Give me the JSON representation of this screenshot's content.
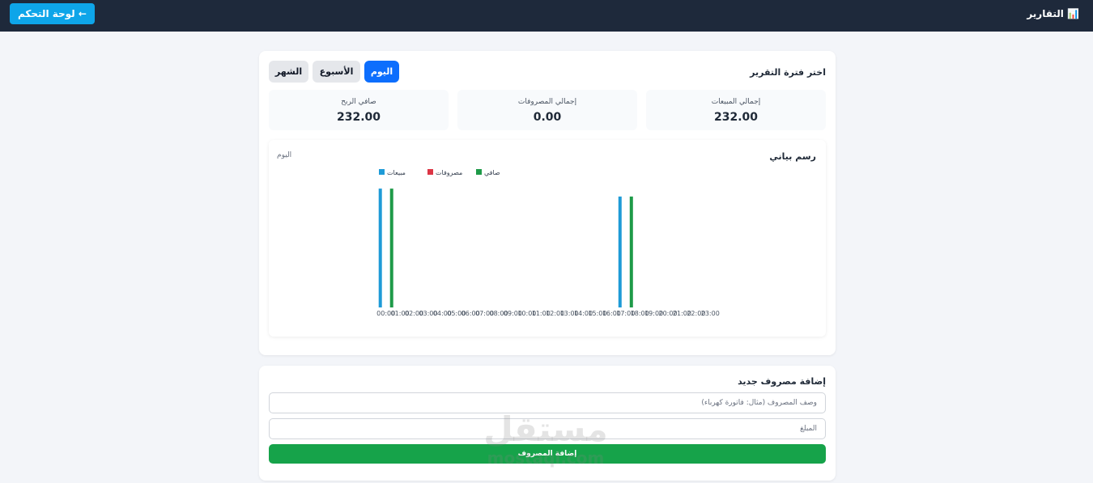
{
  "header": {
    "title": "📊 التقارير",
    "back_label": "← لوحة التحكم"
  },
  "report": {
    "period_title": "اختر فترة التقرير",
    "tabs": {
      "day": "اليوم",
      "week": "الأسبوع",
      "month": "الشهر"
    },
    "active_tab": "day"
  },
  "stats": {
    "sales": {
      "label": "إجمالي المبيعات",
      "value": "232.00"
    },
    "expenses": {
      "label": "إجمالي المصروفات",
      "value": "0.00"
    },
    "profit": {
      "label": "صافي الربح",
      "value": "232.00"
    }
  },
  "chart": {
    "title": "رسم بياني",
    "subtitle": "اليوم"
  },
  "chart_data": {
    "type": "bar",
    "title": "",
    "categories": [
      "00:00",
      "01:00",
      "02:00",
      "03:00",
      "04:00",
      "05:00",
      "06:00",
      "07:00",
      "08:00",
      "09:00",
      "10:00",
      "11:00",
      "12:00",
      "13:00",
      "14:00",
      "15:00",
      "16:00",
      "17:00",
      "18:00",
      "19:00",
      "20:00",
      "21:00",
      "22:00",
      "23:00"
    ],
    "series": [
      {
        "name": "مبيعات",
        "color": "#1f9bd7",
        "values": [
          120,
          0,
          0,
          0,
          0,
          0,
          0,
          0,
          0,
          0,
          0,
          0,
          0,
          0,
          0,
          0,
          0,
          112,
          0,
          0,
          0,
          0,
          0,
          0
        ]
      },
      {
        "name": "مصروفات",
        "color": "#dc3545",
        "values": [
          0,
          0,
          0,
          0,
          0,
          0,
          0,
          0,
          0,
          0,
          0,
          0,
          0,
          0,
          0,
          0,
          0,
          0,
          0,
          0,
          0,
          0,
          0,
          0
        ]
      },
      {
        "name": "صافي",
        "color": "#1e9a48",
        "values": [
          120,
          0,
          0,
          0,
          0,
          0,
          0,
          0,
          0,
          0,
          0,
          0,
          0,
          0,
          0,
          0,
          0,
          112,
          0,
          0,
          0,
          0,
          0,
          0
        ]
      }
    ],
    "ylim": [
      0,
      125
    ],
    "grid": false,
    "legend": "top-left"
  },
  "expense_form": {
    "title": "إضافة مصروف جديد",
    "description_placeholder": "وصف المصروف (مثال: فاتورة كهرباء)",
    "amount_placeholder": "المبلغ",
    "submit_label": "إضافة المصروف"
  },
  "watermark": {
    "arabic": "مستقل",
    "latin": "mostaql.com"
  }
}
